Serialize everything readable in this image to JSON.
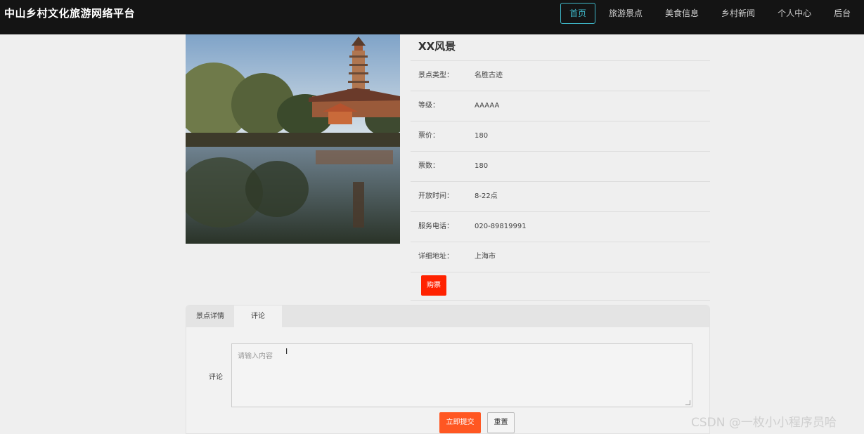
{
  "header": {
    "title": "中山乡村文化旅游网络平台",
    "nav": [
      "首页",
      "旅游景点",
      "美食信息",
      "乡村新闻",
      "个人中心",
      "后台"
    ]
  },
  "spot": {
    "name": "XX风景",
    "fields": [
      {
        "label": "景点类型：",
        "value": "名胜古迹"
      },
      {
        "label": "等级：",
        "value": "AAAAA"
      },
      {
        "label": "票价：",
        "value": "180"
      },
      {
        "label": "票数：",
        "value": "180"
      },
      {
        "label": "开放时间：",
        "value": "8-22点"
      },
      {
        "label": "服务电话：",
        "value": "020-89819991"
      },
      {
        "label": "详细地址：",
        "value": "上海市"
      }
    ],
    "buy_label": "购票"
  },
  "tabs": [
    "景点详情",
    "评论"
  ],
  "comment": {
    "label": "评论",
    "placeholder": "请输入内容",
    "submit_label": "立即提交",
    "reset_label": "重置"
  },
  "watermark": "CSDN @一枚小小程序员哈",
  "colors": {
    "accent": "#3eb6c7",
    "buy": "#ff2200",
    "submit": "#ff5722"
  }
}
